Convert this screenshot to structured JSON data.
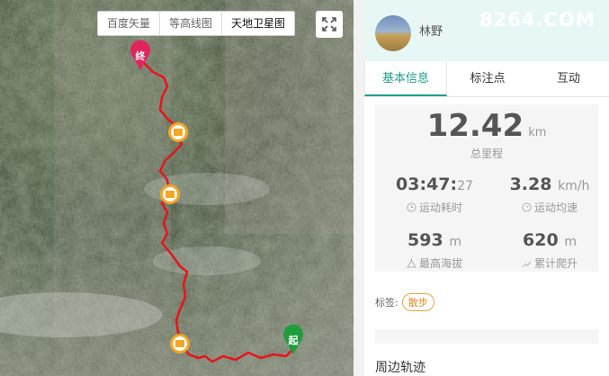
{
  "map": {
    "tabs": [
      {
        "label": "百度矢量",
        "active": false
      },
      {
        "label": "等高线图",
        "active": false
      },
      {
        "label": "天地卫星图",
        "active": true
      }
    ],
    "end_marker": "终",
    "start_marker": "起",
    "route_color": "#e8141c",
    "photo_marker_color": "#f5a623"
  },
  "profile": {
    "username": "林野",
    "watermark": "8264.COM"
  },
  "tabs": [
    {
      "label": "基本信息",
      "active": true
    },
    {
      "label": "标注点",
      "active": false
    },
    {
      "label": "互动",
      "active": false
    }
  ],
  "stats": {
    "distance": {
      "value": "12.42",
      "unit": "km",
      "label": "总里程"
    },
    "time": {
      "value": "03:47:",
      "seconds": "27",
      "label": "运动耗时"
    },
    "speed": {
      "value": "3.28",
      "unit": "km/h",
      "label": "运动均速"
    },
    "max_alt": {
      "value": "593",
      "unit": "m",
      "label": "最高海拔"
    },
    "climb": {
      "value": "620",
      "unit": "m",
      "label": "累计爬升"
    }
  },
  "tags": {
    "label": "标签:",
    "items": [
      "散步"
    ]
  },
  "nearby_title": "周边轨迹",
  "accent": "#1aa08c"
}
